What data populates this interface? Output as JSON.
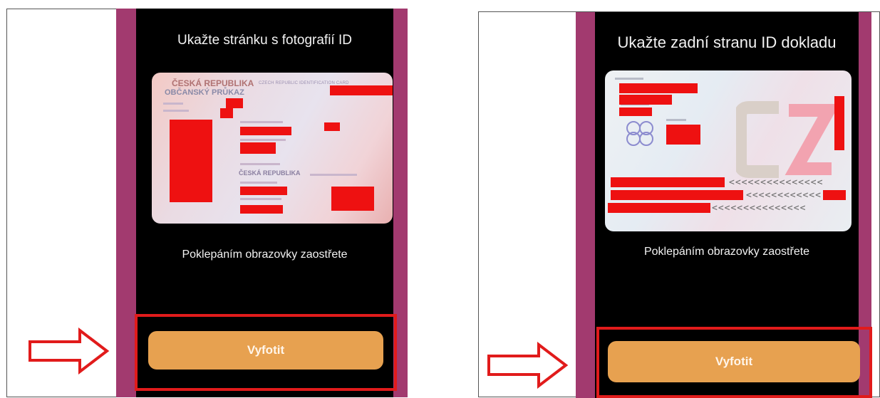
{
  "screens": [
    {
      "title": "Ukažte stránku s fotografií ID",
      "hint": "Poklepáním obrazovky zaostřete",
      "button_label": "Vyfotit",
      "card": {
        "country": "ČESKÁ REPUBLIKA",
        "card_type": "OBČANSKÝ PRŮKAZ",
        "card_type_en": "CZECH REPUBLIC  IDENTIFICATION CARD",
        "nationality_value": "ČESKÁ REPUBLIKA"
      }
    },
    {
      "title": "Ukažte zadní stranu ID dokladu",
      "hint": "Poklepáním obrazovky zaostřete",
      "button_label": "Vyfotit",
      "card": {
        "mrz_line1": "<<<<<<<<<<<<<<<",
        "mrz_line2": "<<<<<<<<<<<<",
        "mrz_line3": "<<<<<<<<<<<<<<<"
      }
    }
  ],
  "colors": {
    "highlight": "#e11b1b",
    "button": "#e7a150",
    "phone_frame": "#a23a6f",
    "screen": "#000000",
    "redaction": "#ee1111"
  }
}
